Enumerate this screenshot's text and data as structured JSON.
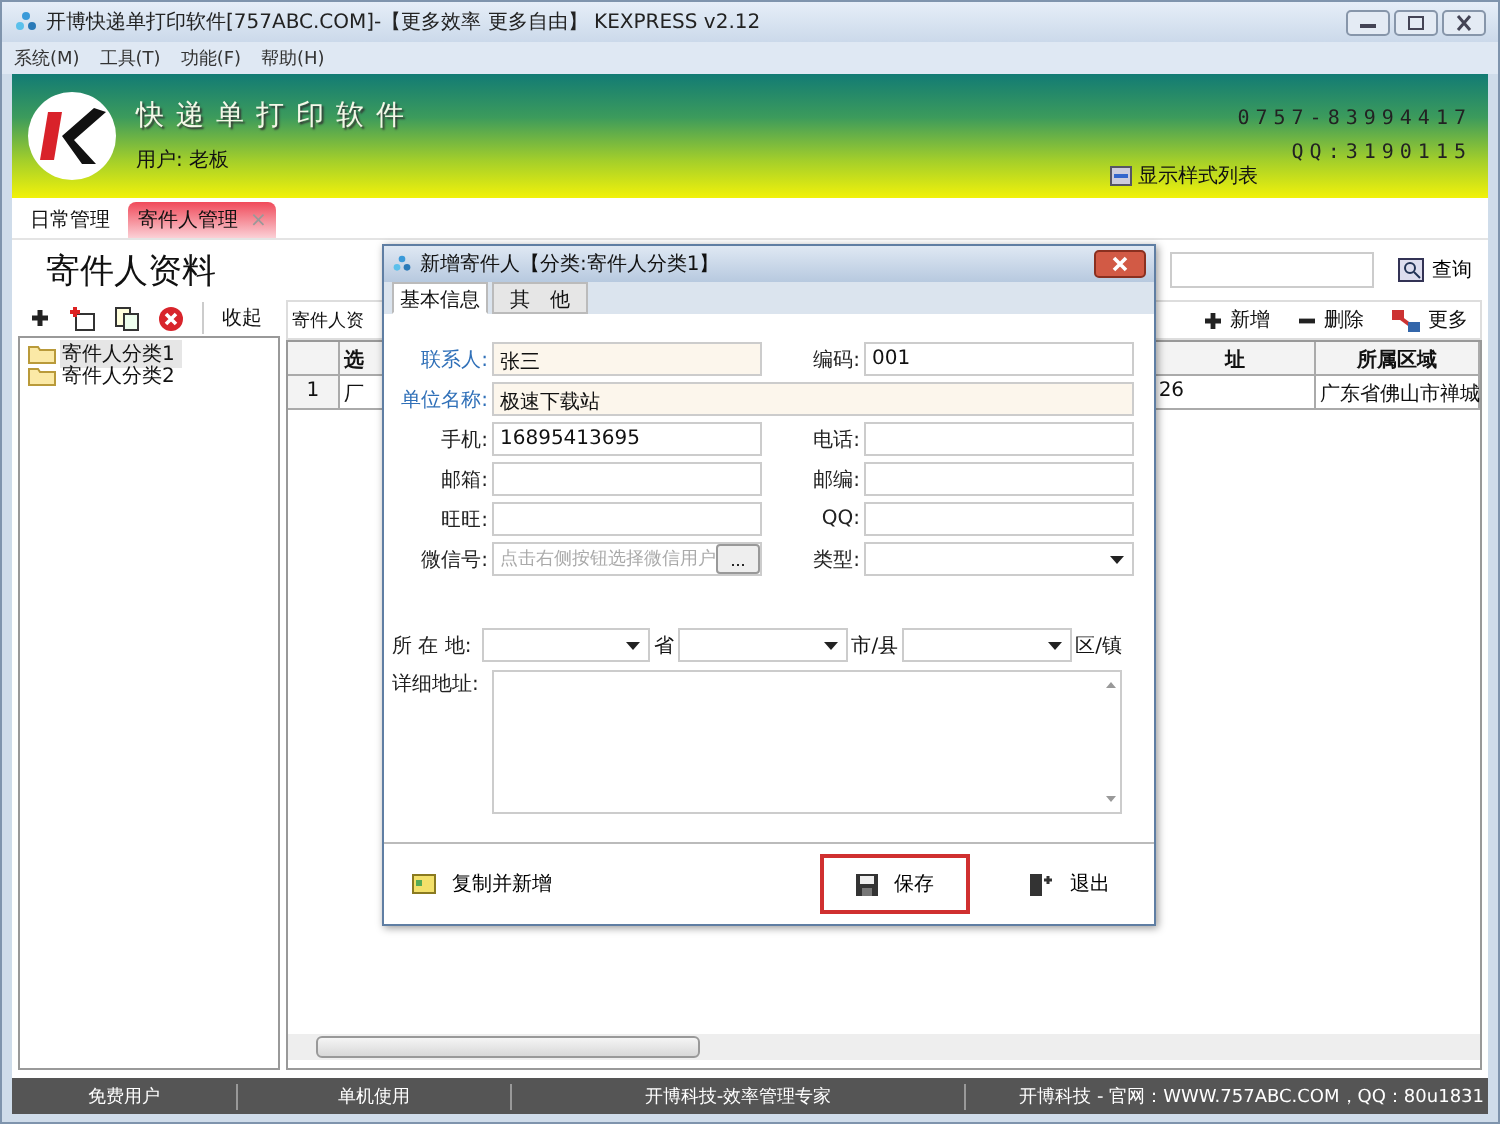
{
  "window": {
    "title": "开博快递单打印软件[757ABC.COM]-【更多效率 更多自由】 KEXPRESS v2.12"
  },
  "menu": [
    "系统(M)",
    "工具(T)",
    "功能(F)",
    "帮助(H)"
  ],
  "banner": {
    "app_name": "快递单打印软件",
    "user": "用户: 老板",
    "show_styles": "显示样式列表",
    "phone": "0757-83994417",
    "qq": "QQ:3190115"
  },
  "tabs": [
    {
      "label": "日常管理",
      "selected": false
    },
    {
      "label": "寄件人管理",
      "selected": true,
      "close": "×"
    }
  ],
  "page_title": "寄件人资料",
  "search_button": "查询",
  "left_toolbar": {
    "collapse": "收起"
  },
  "tree": [
    {
      "label": "寄件人分类1",
      "selected": true
    },
    {
      "label": "寄件人分类2",
      "selected": false
    }
  ],
  "list_toolbar": {
    "label": "寄件人资",
    "actions": [
      "新增",
      "删除",
      "更多"
    ]
  },
  "table": {
    "columns": [
      "",
      "选",
      "址",
      "所属区域"
    ],
    "rows": [
      [
        "1",
        "厂",
        "26",
        "广东省佛山市禅城"
      ]
    ]
  },
  "dialog": {
    "title": "新增寄件人【分类:寄件人分类1】",
    "tabs": [
      {
        "label": "基本信息",
        "selected": true
      },
      {
        "label": "其　他",
        "selected": false
      }
    ],
    "fields": [
      {
        "kind": "text",
        "label": "联系人:",
        "value": "张三",
        "required": true
      },
      {
        "kind": "text",
        "label": "编码:",
        "value": "001",
        "required": false
      },
      {
        "kind": "wide",
        "label": "单位名称:",
        "value": "极速下载站",
        "required": true
      },
      {
        "kind": "text",
        "label": "手机:",
        "value": "16895413695",
        "required": false
      },
      {
        "kind": "text",
        "label": "电话:",
        "required": false
      },
      {
        "kind": "text",
        "label": "邮箱:",
        "required": false
      },
      {
        "kind": "text",
        "label": "邮编:",
        "required": false
      },
      {
        "kind": "text",
        "label": "旺旺:",
        "required": false
      },
      {
        "kind": "text",
        "label": "QQ:",
        "required": false
      },
      {
        "kind": "picker",
        "label": "微信号:",
        "placeholder": "点击右侧按钮选择微信用户",
        "button": "...",
        "required": false
      },
      {
        "kind": "select",
        "label": "类型:",
        "required": false
      }
    ],
    "location": {
      "label": "所 在 地:",
      "units": [
        "省",
        "市/县",
        "区/镇"
      ]
    },
    "address": {
      "label": "详细地址:"
    },
    "copy_button": "复制并新增",
    "save_button": {
      "label": "保存",
      "highlighted": true
    },
    "exit_button": "退出"
  },
  "status_bar": [
    "免费用户",
    "单机使用",
    "开博科技-效率管理专家",
    "开博科技 - 官网：WWW.757ABC.COM，QQ：80u1831"
  ]
}
